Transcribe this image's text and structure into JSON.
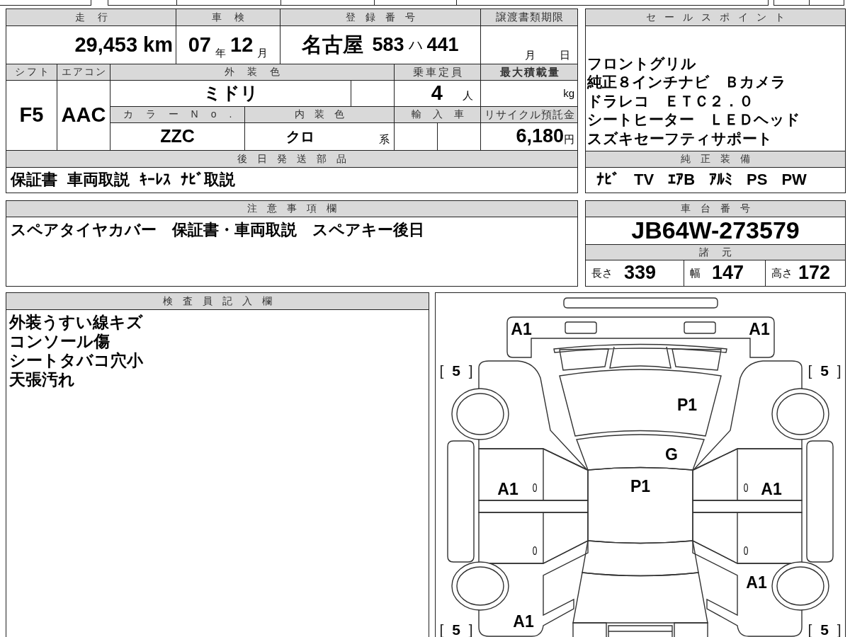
{
  "vehicle_info": {
    "mileage": {
      "label": "走行",
      "value": "29,453",
      "unit": "km"
    },
    "inspection": {
      "label": "車検",
      "year": "07",
      "year_unit": "年",
      "month": "12",
      "month_unit": "月"
    },
    "registration": {
      "label": "登録番号",
      "region": "名古屋",
      "class_number": "583",
      "kana": "ハ",
      "serial": "441"
    },
    "transfer_deadline": {
      "label": "譲渡書類期限",
      "month_unit": "月",
      "day_unit": "日"
    },
    "shift": {
      "label": "シフト",
      "value": "F5"
    },
    "air_conditioning": {
      "label": "エアコン",
      "value": "AAC"
    },
    "exterior_color": {
      "label": "外装色",
      "value": "ミドリ"
    },
    "capacity": {
      "label": "乗車定員",
      "value": "4",
      "unit": "人"
    },
    "max_load": {
      "label": "最大積載量",
      "unit": "kg"
    },
    "color_number": {
      "label": "カラーNo.",
      "value": "ZZC"
    },
    "interior_color": {
      "label": "内装色",
      "value": "クロ",
      "suffix": "系"
    },
    "imported": {
      "label": "輸入車"
    },
    "recycling_fee": {
      "label": "リサイクル預託金",
      "value": "6,180",
      "unit": "円"
    },
    "later_parts": {
      "label": "後日発送部品",
      "value": "保証書 車両取説 ｷｰﾚｽ ﾅﾋﾞ取説"
    }
  },
  "sale_points": {
    "label": "セールスポイント",
    "lines": [
      "フロントグリル",
      "純正８インチナビ　Ｂカメラ",
      "ドラレコ　ＥＴＣ２．０",
      "シートヒーター　ＬＥＤヘッド",
      "スズキセーフティサポート"
    ]
  },
  "standard_equipment": {
    "label": "純正装備",
    "items": [
      "ﾅﾋﾞ",
      "TV",
      "ｴｱB",
      "ｱﾙﾐ",
      "PS",
      "PW"
    ]
  },
  "notes": {
    "label": "注意事項欄",
    "text": "スペアタイヤカバー　保証書・車両取説　スペアキー後日"
  },
  "chassis": {
    "label": "車台番号",
    "value": "JB64W-273579"
  },
  "dimensions": {
    "label": "諸元",
    "items": [
      {
        "label": "長さ",
        "value": "339"
      },
      {
        "label": "幅",
        "value": "147"
      },
      {
        "label": "高さ",
        "value": "172"
      }
    ]
  },
  "inspector_notes": {
    "label": "検査員記入欄",
    "lines": [
      "外装うすい線キズ",
      "コンソール傷",
      "シートタバコ穴小",
      "天張汚れ"
    ]
  },
  "damage_diagram": {
    "front_bumper_left": {
      "kind": "code",
      "text": "A1"
    },
    "front_bumper_right": {
      "kind": "code",
      "text": "A1"
    },
    "front_tire_left": {
      "kind": "tire",
      "text": "[ **5** ]"
    },
    "front_tire_right": {
      "kind": "tire",
      "text": "[ **5** ]"
    },
    "bonnet": {
      "kind": "code",
      "text": "P1"
    },
    "windshield": {
      "kind": "code",
      "text": "G"
    },
    "front_door_left": {
      "kind": "code",
      "text": "A1"
    },
    "front_door_left_inner": {
      "kind": "minor",
      "text": "0"
    },
    "roof": {
      "kind": "code",
      "text": "P1"
    },
    "front_door_right_inner": {
      "kind": "minor",
      "text": "0"
    },
    "front_door_right": {
      "kind": "code",
      "text": "A1"
    },
    "rear_door_left_inner": {
      "kind": "minor",
      "text": "0"
    },
    "rear_door_right_inner": {
      "kind": "minor",
      "text": "0"
    },
    "rear_quarter_right": {
      "kind": "code",
      "text": "A1"
    },
    "rear_tire_left": {
      "kind": "tire",
      "text": "[ **5** ]"
    },
    "rear_quarter_left": {
      "kind": "code",
      "text": "A1"
    },
    "rear_tire_right": {
      "kind": "tire",
      "text": "[ **5** ]"
    }
  }
}
